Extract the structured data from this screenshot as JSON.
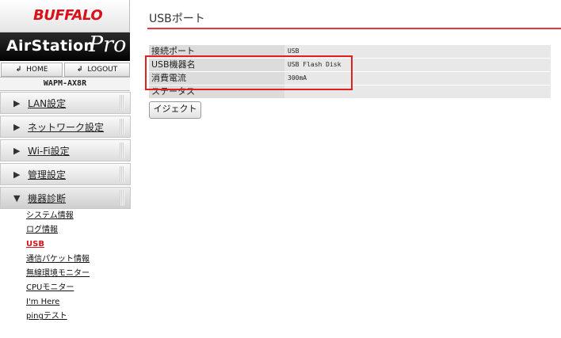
{
  "brand": {
    "logo": "BUFFALO",
    "product": "AirStation",
    "product_suffix": "Pro",
    "model": "WAPM-AX8R"
  },
  "nav": {
    "home_label": "HOME",
    "logout_label": "LOGOUT"
  },
  "menu": [
    {
      "label": "LAN設定"
    },
    {
      "label": "ネットワーク設定"
    },
    {
      "label": "Wi-Fi設定"
    },
    {
      "label": "管理設定"
    },
    {
      "label": "機器診断"
    }
  ],
  "submenu": [
    {
      "label": "システム情報"
    },
    {
      "label": "ログ情報"
    },
    {
      "label": "USB"
    },
    {
      "label": "通信パケット情報"
    },
    {
      "label": "無線環境モニター"
    },
    {
      "label": "CPUモニター"
    },
    {
      "label": "I'm Here"
    },
    {
      "label": "pingテスト"
    }
  ],
  "page": {
    "title": "USBポート",
    "table": [
      {
        "key": "接続ポート",
        "value": "USB"
      },
      {
        "key": "USB機器名",
        "value": "USB Flash Disk"
      },
      {
        "key": "消費電流",
        "value": "300mA"
      },
      {
        "key": "ステータス",
        "value": ""
      }
    ],
    "eject_label": "イジェクト"
  },
  "colors": {
    "brand_red": "#d9111b",
    "accent_rule": "#e53935",
    "highlight": "#e0201f"
  }
}
